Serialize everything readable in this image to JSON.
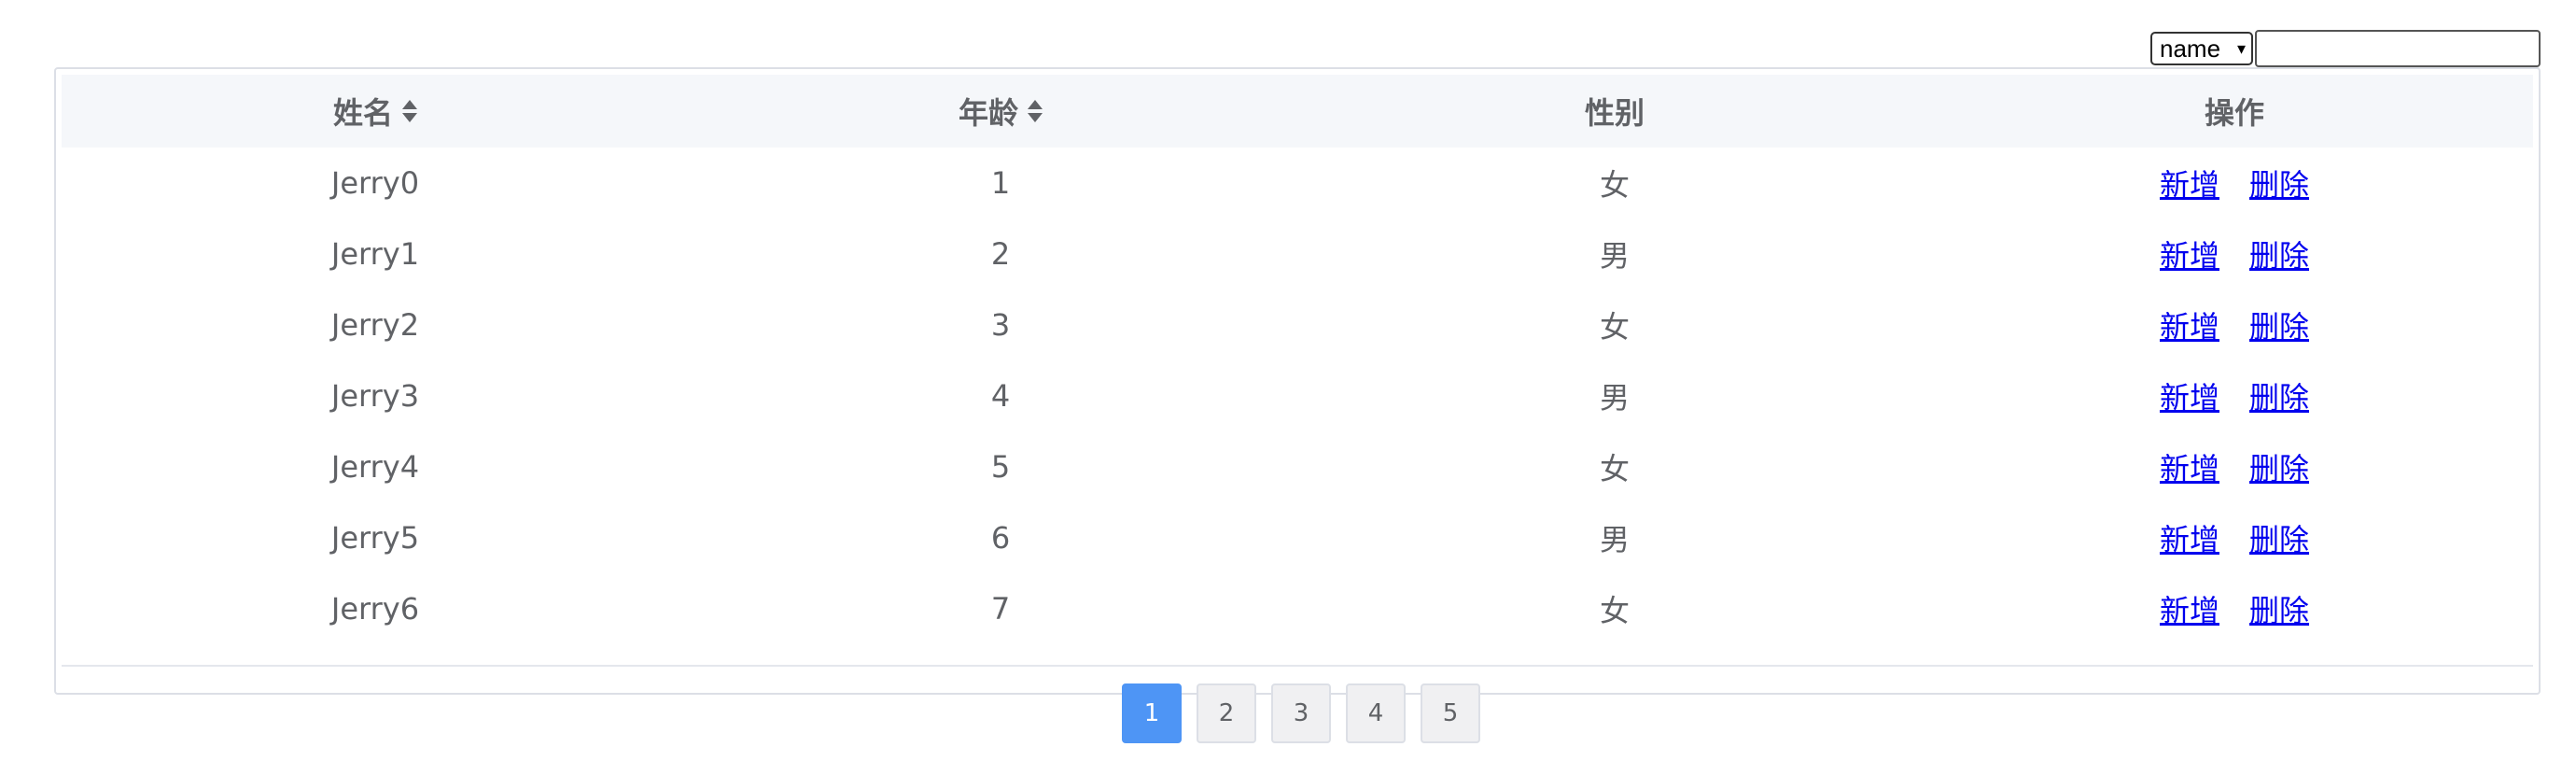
{
  "search": {
    "field_selected": "name",
    "field_options": [
      "name"
    ],
    "value": "",
    "placeholder": ""
  },
  "table": {
    "headers": [
      {
        "label": "姓名",
        "sortable": true
      },
      {
        "label": "年龄",
        "sortable": true
      },
      {
        "label": "性别",
        "sortable": false
      },
      {
        "label": "操作",
        "sortable": false
      }
    ],
    "rows": [
      {
        "name": "Jerry0",
        "age": "1",
        "gender": "女"
      },
      {
        "name": "Jerry1",
        "age": "2",
        "gender": "男"
      },
      {
        "name": "Jerry2",
        "age": "3",
        "gender": "女"
      },
      {
        "name": "Jerry3",
        "age": "4",
        "gender": "男"
      },
      {
        "name": "Jerry4",
        "age": "5",
        "gender": "女"
      },
      {
        "name": "Jerry5",
        "age": "6",
        "gender": "男"
      },
      {
        "name": "Jerry6",
        "age": "7",
        "gender": "女"
      }
    ],
    "actions": {
      "add_label": "新增",
      "delete_label": "删除"
    }
  },
  "pagination": {
    "pages": [
      "1",
      "2",
      "3",
      "4",
      "5"
    ],
    "current": "1"
  },
  "icons": {
    "sort": "sort-caret-icon",
    "select_chevron": "chevron-down-icon"
  },
  "colors": {
    "accent": "#4e95f5",
    "link": "#0000ee",
    "text": "#606266",
    "header_bg": "#f5f7fa"
  }
}
